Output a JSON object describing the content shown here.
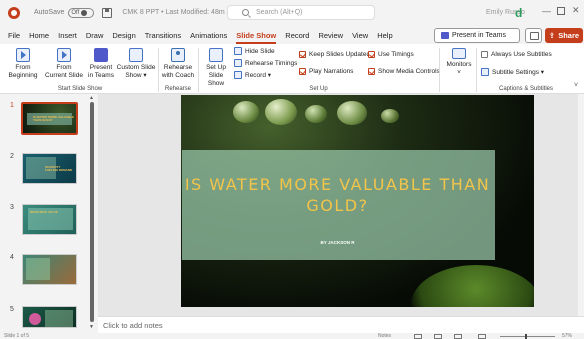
{
  "titlebar": {
    "autosave_label": "AutoSave",
    "autosave_state": "Off",
    "file_title": "CMK 8 PPT • Last Modified: 48m ago",
    "search_placeholder": "Search (Alt+Q)",
    "user_name": "Emily Russo",
    "user_initial": "d",
    "min_glyph": "—",
    "close_glyph": "✕"
  },
  "tabs": [
    "File",
    "Home",
    "Insert",
    "Draw",
    "Design",
    "Transitions",
    "Animations",
    "Slide Show",
    "Record",
    "Review",
    "View",
    "Help"
  ],
  "active_tab": "Slide Show",
  "header_buttons": {
    "present_in_teams": "Present in Teams",
    "share": "Share"
  },
  "ribbon": {
    "from_beginning": [
      "From",
      "Beginning"
    ],
    "from_current": [
      "From",
      "Current Slide"
    ],
    "present_teams": [
      "Present",
      "in Teams"
    ],
    "custom_show": [
      "Custom Slide",
      "Show ▾"
    ],
    "rehearse_coach": [
      "Rehearse",
      "with Coach"
    ],
    "set_up": [
      "Set Up",
      "Slide Show"
    ],
    "hide_slide": "Hide Slide",
    "rehearse_timings": "Rehearse Timings",
    "record": "Record ▾",
    "keep_slides_updated": "Keep Slides Updated",
    "use_timings": "Use Timings",
    "play_narrations": "Play Narrations",
    "show_media_controls": "Show Media Controls",
    "monitors": "Monitors",
    "always_use_subtitles": "Always Use Subtitles",
    "subtitle_settings": "Subtitle Settings ▾",
    "groups": {
      "start": "Start Slide Show",
      "rehearse": "Rehearse",
      "setup": "Set Up",
      "captions": "Captions & Subtitles"
    }
  },
  "slides": [
    {
      "num": "1",
      "title": "IS WATER MORE VALUABLE THAN GOLD?"
    },
    {
      "num": "2",
      "title": "SCARCITY FUELING DEMAND"
    },
    {
      "num": "3",
      "title": "RESOURCE VALUE"
    },
    {
      "num": "4",
      "title": ""
    },
    {
      "num": "5",
      "title": ""
    }
  ],
  "current_slide": {
    "title": "IS WATER MORE VALUABLE THAN GOLD?",
    "subtitle": "BY JACKSON R"
  },
  "notes_placeholder": "Click to add notes",
  "status": {
    "slide_count": "Slide 1 of 5",
    "notes_label": "Notes",
    "zoom": "57%"
  },
  "colors": {
    "accent": "#c43e1c",
    "title_gold": "#f2c44a",
    "band": "#91bea0"
  }
}
